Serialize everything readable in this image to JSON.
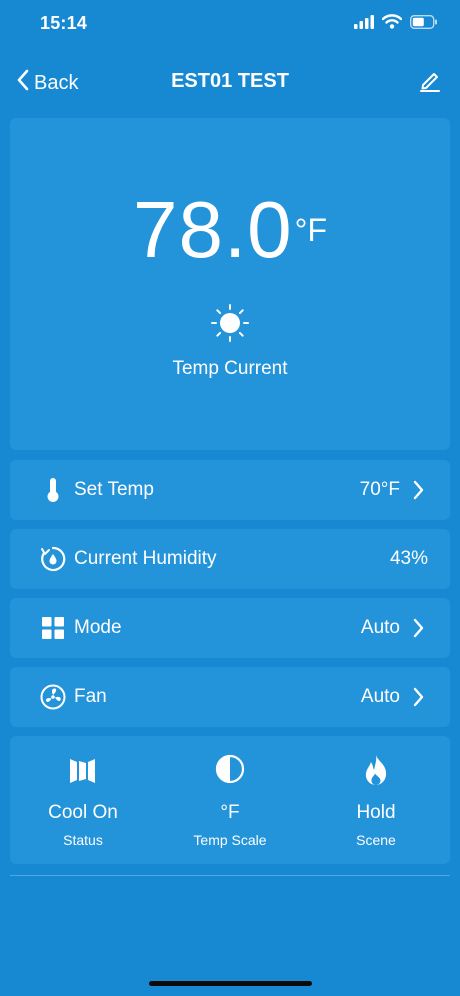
{
  "status_bar": {
    "time": "15:14",
    "icons": [
      "signal-icon",
      "wifi-icon",
      "battery-icon"
    ]
  },
  "nav": {
    "back_label": "Back",
    "title": "EST01 TEST",
    "edit_icon": "pencil-icon"
  },
  "hero": {
    "temp_value": "78.0",
    "temp_unit": "°F",
    "icon": "sun-icon",
    "label": "Temp Current"
  },
  "rows": {
    "set_temp": {
      "label": "Set Temp",
      "value": "70°F",
      "icon": "thermometer-icon"
    },
    "humidity": {
      "label": "Current Humidity",
      "value": "43%",
      "icon": "humidity-icon"
    },
    "mode": {
      "label": "Mode",
      "value": "Auto",
      "icon": "grid-icon"
    },
    "fan": {
      "label": "Fan",
      "value": "Auto",
      "icon": "fan-icon"
    }
  },
  "status_panel": {
    "status": {
      "value": "Cool On",
      "label": "Status",
      "icon": "cool-panel-icon"
    },
    "scale": {
      "value": "°F",
      "label": "Temp Scale",
      "icon": "half-circle-icon"
    },
    "scene": {
      "value": "Hold",
      "label": "Scene",
      "icon": "flame-icon"
    }
  },
  "colors": {
    "background": "#1789d3",
    "card": "#2393da",
    "text": "#ffffff"
  }
}
